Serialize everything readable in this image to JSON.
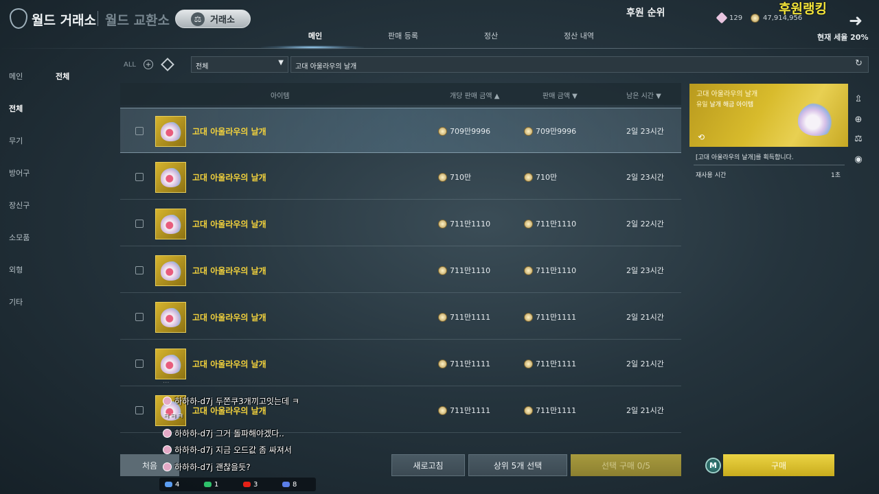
{
  "header": {
    "title_main": "월드 거래소",
    "title_sub": "월드 교환소",
    "pill_label": "거래소",
    "pill_icon": "scale-icon",
    "rank_title": "후원 순위",
    "rank_banner": "후원랭킹",
    "gem_count": "129",
    "coin_count": "47,914,956",
    "tax_text": "현재 세율 20%",
    "tabs": [
      {
        "label": "메인",
        "active": true
      },
      {
        "label": "판매 등록",
        "active": false
      },
      {
        "label": "정산",
        "active": false
      },
      {
        "label": "정산 내역",
        "active": false
      }
    ]
  },
  "left_nav": {
    "items": [
      {
        "label": "메인",
        "active": false
      },
      {
        "label": "전체",
        "active": true
      },
      {
        "label": "무기",
        "active": false
      },
      {
        "label": "방어구",
        "active": false
      },
      {
        "label": "장신구",
        "active": false
      },
      {
        "label": "소모품",
        "active": false
      },
      {
        "label": "외형",
        "active": false
      },
      {
        "label": "기타",
        "active": false
      }
    ],
    "sub_selected": "전체"
  },
  "filters": {
    "all_label": "ALL",
    "category_select": "전체",
    "search_value": "고대 아울라우의 날개"
  },
  "table": {
    "headers": {
      "item": "아이템",
      "unit_price": "개당 판매 금액",
      "total_price": "판매 금액",
      "remaining": "남은 시간"
    },
    "rows": [
      {
        "name": "고대 아울라우의 날개",
        "unit_price": "709만9996",
        "total_price": "709만9996",
        "time": "2일 23시간",
        "selected": true
      },
      {
        "name": "고대 아울라우의 날개",
        "unit_price": "710만",
        "total_price": "710만",
        "time": "2일 23시간",
        "selected": false
      },
      {
        "name": "고대 아울라우의 날개",
        "unit_price": "711만1110",
        "total_price": "711만1110",
        "time": "2일 22시간",
        "selected": false
      },
      {
        "name": "고대 아울라우의 날개",
        "unit_price": "711만1110",
        "total_price": "711만1110",
        "time": "2일 23시간",
        "selected": false
      },
      {
        "name": "고대 아울라우의 날개",
        "unit_price": "711만1111",
        "total_price": "711만1111",
        "time": "2일 21시간",
        "selected": false
      },
      {
        "name": "고대 아울라우의 날개",
        "unit_price": "711만1111",
        "total_price": "711만1111",
        "time": "2일 21시간",
        "selected": false
      },
      {
        "name": "고대 아울라우의 날개",
        "unit_price": "711만1111",
        "total_price": "711만1111",
        "time": "2일 21시간",
        "selected": false
      }
    ]
  },
  "detail": {
    "title": "고대 아울라우의 날개",
    "subtitle_prefix": "유일",
    "subtitle": "날개 해금 아이템",
    "description": "[고대 아울라우의 날개]를 획득합니다.",
    "cooldown_label": "재사용 시간",
    "cooldown_value": "1초"
  },
  "bottom": {
    "first_label": "처음",
    "refresh_label": "새로고침",
    "select_top5_label": "상위 5개 선택",
    "buy_selected_label": "선택 구매 0/5",
    "buy_label": "구매",
    "m_icon_label": "M"
  },
  "chat": {
    "messages": [
      {
        "user": "하하하-d7j",
        "text": "두쫀쿠3개끼고잇는데 ㅋ"
      },
      {
        "user": "하하하-d7j",
        "text": "그거 돌파해야겠다.."
      },
      {
        "user": "하하하-d7j",
        "text": "지금 오드값 좀 싸져서"
      },
      {
        "user": "하하하-d7j",
        "text": "괜찮을듯?"
      }
    ],
    "kk_line": "ㅋㅋㅋ",
    "stats": [
      {
        "icon": "link-icon",
        "value": "4",
        "color": "#5b9cf0"
      },
      {
        "icon": "up-arrow-icon",
        "value": "1",
        "color": "#2ec06a"
      },
      {
        "icon": "youtube-icon",
        "value": "3",
        "color": "#e62117"
      },
      {
        "icon": "chat-icon",
        "value": "8",
        "color": "#5a7ee8"
      }
    ]
  },
  "colors": {
    "gold_name": "#f3d23c",
    "buy_button": "#e0c63a",
    "rank_banner": "#f5e53a"
  }
}
